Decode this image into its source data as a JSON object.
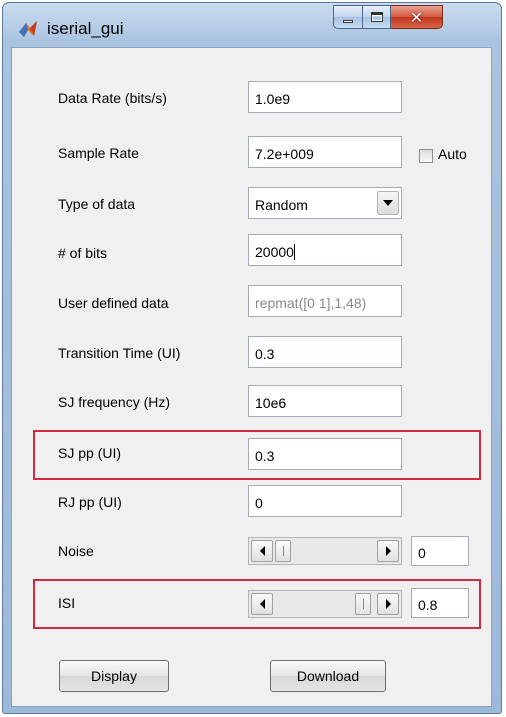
{
  "window": {
    "title": "iserial_gui",
    "colors": {
      "frame": "#a9c3e0",
      "client": "#f0f0f0",
      "highlight": "#d22b40",
      "close": "#c2361c"
    }
  },
  "fields": {
    "data_rate": {
      "label": "Data Rate (bits/s)",
      "value": "1.0e9"
    },
    "sample_rate": {
      "label": "Sample Rate",
      "value": "7.2e+009"
    },
    "auto": {
      "label": "Auto",
      "checked": false
    },
    "data_type": {
      "label": "Type of data",
      "selected": "Random"
    },
    "num_bits": {
      "label": "# of bits",
      "value": "20000"
    },
    "user_data": {
      "label": "User defined data",
      "value": "repmat([0 1],1,48)"
    },
    "transition": {
      "label": "Transition Time (UI)",
      "value": "0.3"
    },
    "sj_freq": {
      "label": "SJ frequency (Hz)",
      "value": "10e6"
    },
    "sj_pp": {
      "label": "SJ pp (UI)",
      "value": "0.3"
    },
    "rj_pp": {
      "label": "RJ pp (UI)",
      "value": "0"
    },
    "noise": {
      "label": "Noise",
      "value": "0"
    },
    "isi": {
      "label": "ISI",
      "value": "0.8"
    }
  },
  "buttons": {
    "display": "Display",
    "download": "Download"
  }
}
